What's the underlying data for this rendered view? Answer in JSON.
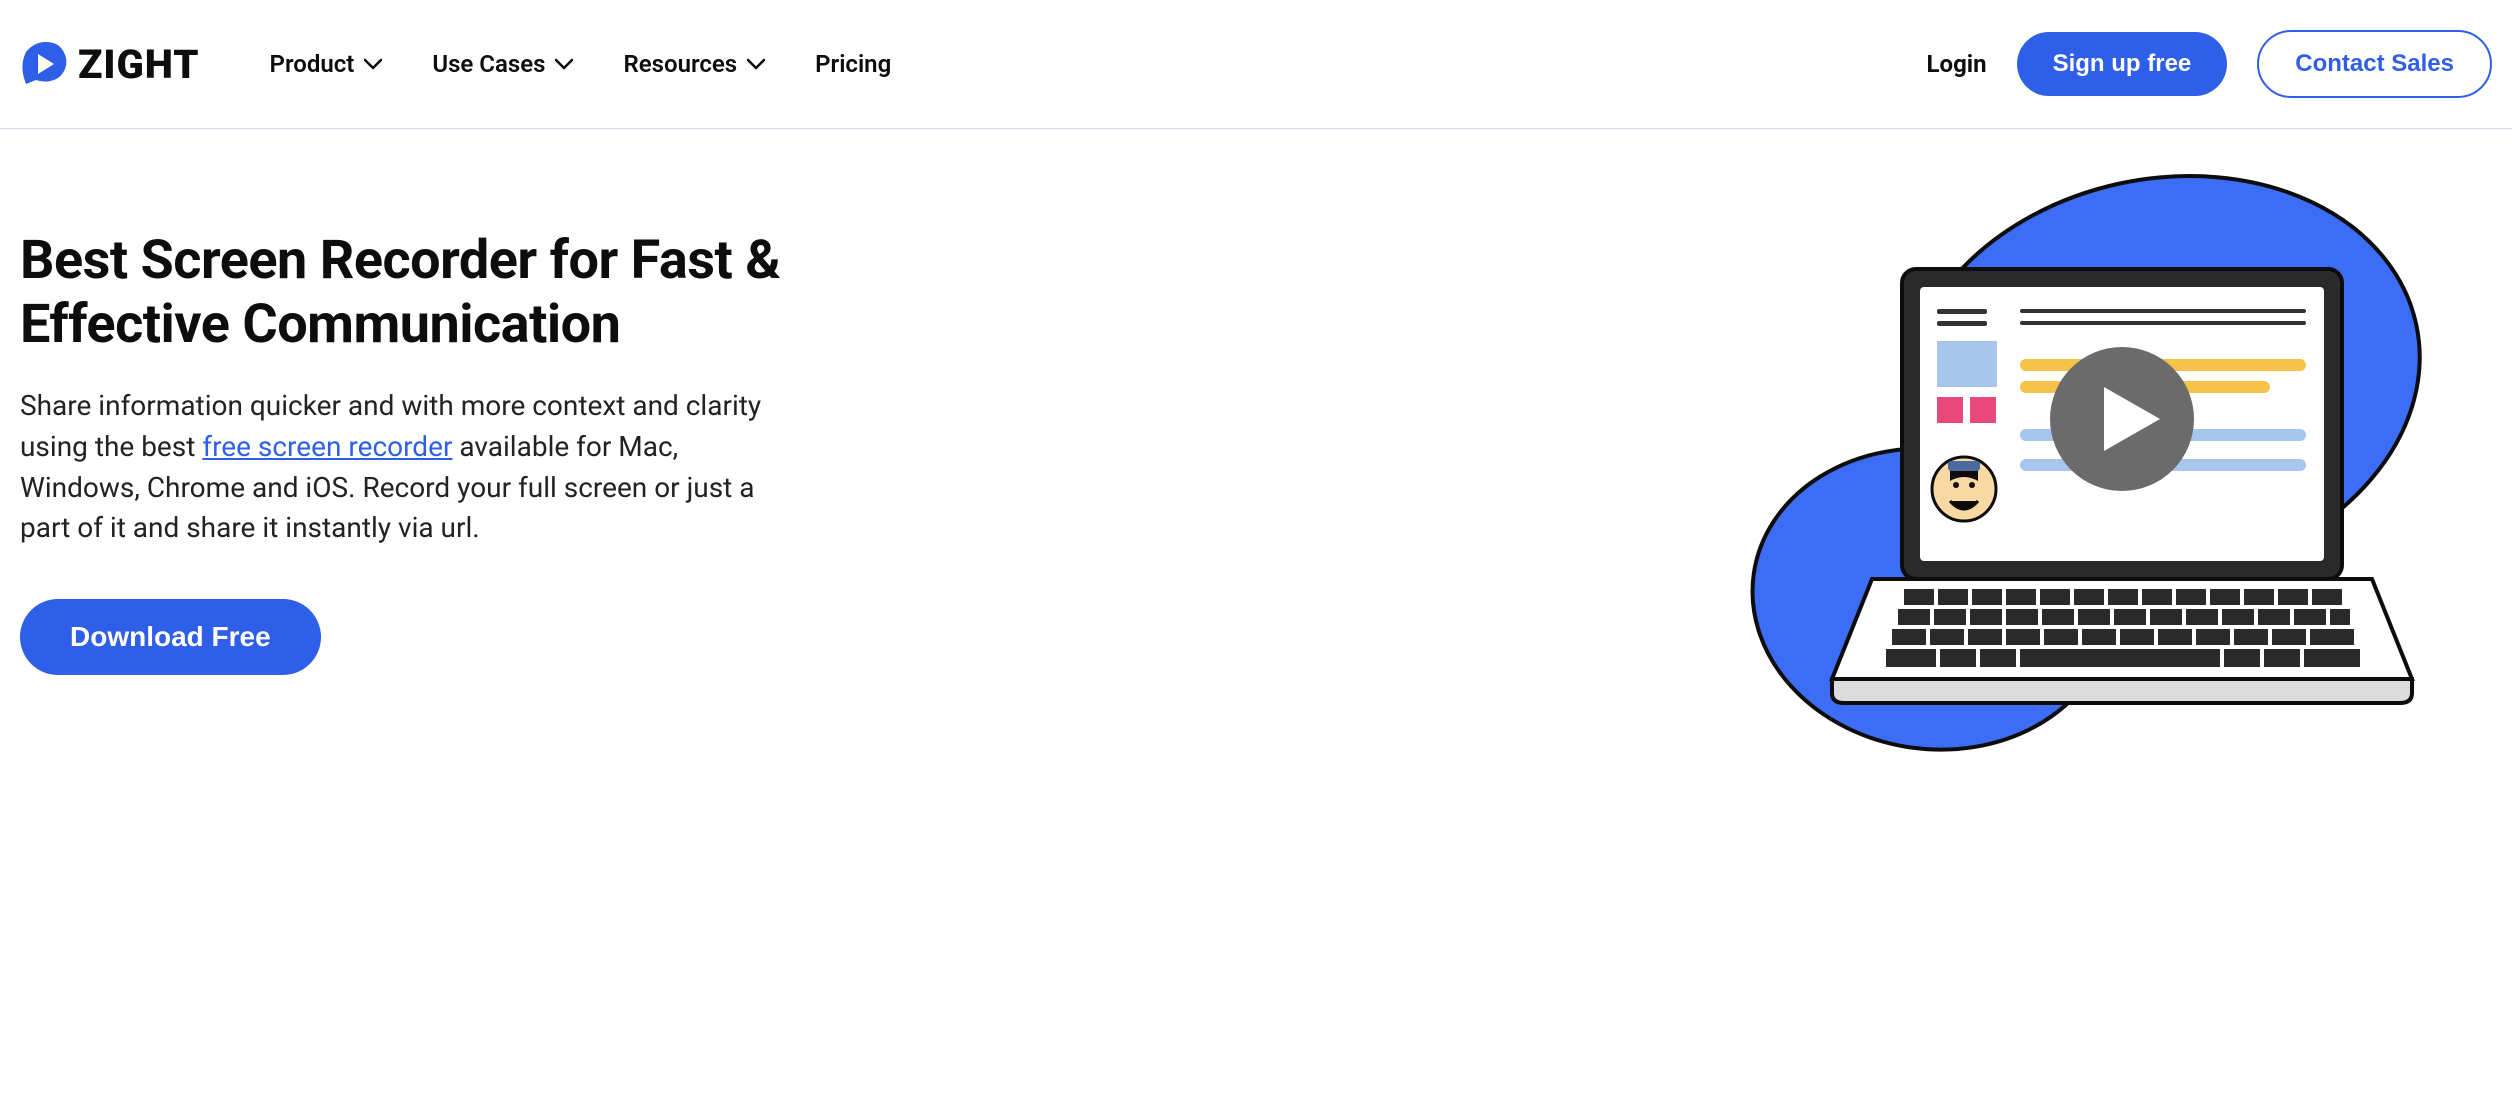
{
  "brand": {
    "name": "ZIGHT"
  },
  "nav": {
    "items": [
      {
        "label": "Product",
        "hasDropdown": true
      },
      {
        "label": "Use Cases",
        "hasDropdown": true
      },
      {
        "label": "Resources",
        "hasDropdown": true
      },
      {
        "label": "Pricing",
        "hasDropdown": false
      }
    ]
  },
  "header": {
    "login": "Login",
    "signup": "Sign up free",
    "contact": "Contact Sales"
  },
  "hero": {
    "title": "Best Screen Recorder for Fast & Effective Communication",
    "desc_part1": "Share information quicker and with more context and clarity using the best ",
    "desc_link": "free screen recorder",
    "desc_part2": " available for Mac, Windows, Chrome and iOS. Record your full screen or just a part of it and share it instantly via url.",
    "cta": "Download Free"
  },
  "colors": {
    "primary": "#2f5ee8",
    "text": "#0d0d0d"
  }
}
